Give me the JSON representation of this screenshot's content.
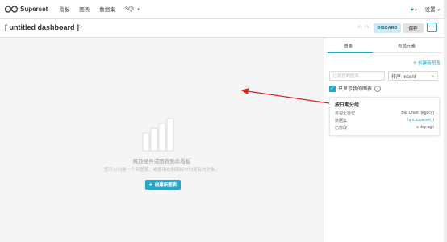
{
  "nav": {
    "brand": "Superset",
    "items": [
      "看板",
      "图表",
      "数据集",
      "SQL"
    ],
    "sql_caret": "▾",
    "plus": "+",
    "plus_caret": "▾",
    "settings": "设置",
    "settings_caret": "▾"
  },
  "header": {
    "title": "[ untitled dashboard ]",
    "discard": "DISCARD",
    "save": "保存",
    "more": "···"
  },
  "canvas": {
    "empty_title": "拖放组件或图表到此看板",
    "empty_desc": "您可以创建一个新图表，或使用右侧面板中的现有的对象。",
    "create_button": "创建新图表"
  },
  "panel": {
    "tabs": [
      "图表",
      "布局元素"
    ],
    "active_tab": 0,
    "create_link": "创建新图表",
    "filter_placeholder": "过滤您的图表",
    "sort_value": "排序 recent",
    "only_mine_label": "只显示我的图表",
    "only_mine_checked": true,
    "card": {
      "title": "按日期分组",
      "rows": [
        {
          "label": "可视化类型",
          "value": "Bar Chart (legacy)",
          "link": false
        },
        {
          "label": "数据集",
          "value": "hjm.superset_t",
          "link": true
        },
        {
          "label": "已修改",
          "value": "a day ago",
          "link": false
        }
      ]
    }
  },
  "colors": {
    "accent": "#20a7c9",
    "arrow": "#e0201f"
  }
}
